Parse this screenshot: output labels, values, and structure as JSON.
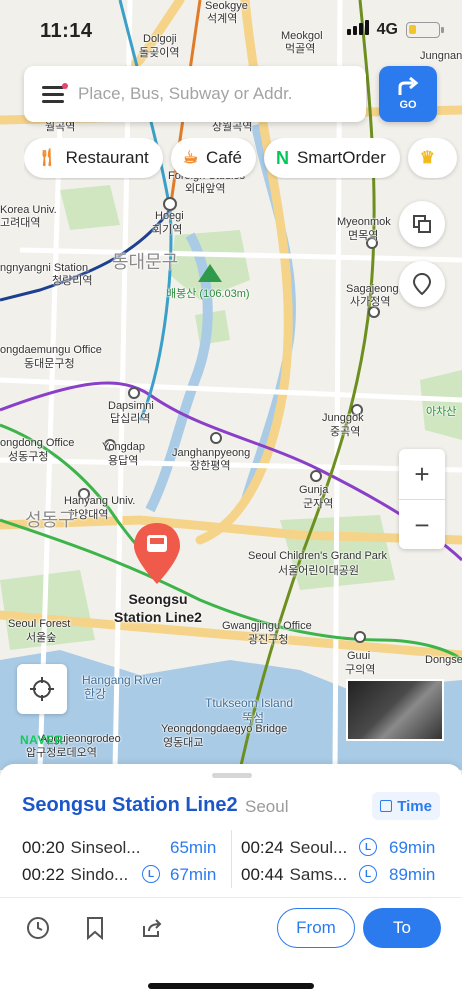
{
  "status_bar": {
    "time": "11:14",
    "network": "4G"
  },
  "search": {
    "placeholder": "Place, Bus, Subway or Addr.",
    "go_label": "GO"
  },
  "categories": [
    {
      "label": "Restaurant",
      "icon": "fork-icon",
      "color": "#f28a2e"
    },
    {
      "label": "Café",
      "icon": "cup-icon",
      "color": "#f28a2e"
    },
    {
      "label": "SmartOrder",
      "icon": "n-icon",
      "color": "#03c75a"
    }
  ],
  "map": {
    "labels": [
      {
        "text": "Seokgye",
        "cls": ""
      },
      {
        "text": "석계역",
        "cls": ""
      },
      {
        "text": "Meokgol",
        "cls": ""
      },
      {
        "text": "먹골역",
        "cls": ""
      },
      {
        "text": "Jungnan",
        "cls": ""
      },
      {
        "text": "Dolgoji",
        "cls": ""
      },
      {
        "text": "돌곶이역",
        "cls": ""
      },
      {
        "text": "월곡역",
        "cls": ""
      },
      {
        "text": "상월곡역",
        "cls": ""
      },
      {
        "text": "Korea Univ.",
        "cls": ""
      },
      {
        "text": "고려대역",
        "cls": ""
      },
      {
        "text": "Foreign Studies",
        "cls": ""
      },
      {
        "text": "외대앞역",
        "cls": ""
      },
      {
        "text": "Hoegi",
        "cls": ""
      },
      {
        "text": "회기역",
        "cls": ""
      },
      {
        "text": "Myeonmok",
        "cls": ""
      },
      {
        "text": "면목역",
        "cls": ""
      },
      {
        "text": "ngnyangni Station",
        "cls": ""
      },
      {
        "text": "청량리역",
        "cls": ""
      },
      {
        "text": "동대문구",
        "cls": "big"
      },
      {
        "text": "배봉산 (106.03m)",
        "cls": "green"
      },
      {
        "text": "Sagajeong",
        "cls": ""
      },
      {
        "text": "사가정역",
        "cls": ""
      },
      {
        "text": "ongdaemungu Office",
        "cls": ""
      },
      {
        "text": "동대문구청",
        "cls": ""
      },
      {
        "text": "Dapsimni",
        "cls": ""
      },
      {
        "text": "답십리역",
        "cls": ""
      },
      {
        "text": "Junggok",
        "cls": ""
      },
      {
        "text": "중곡역",
        "cls": ""
      },
      {
        "text": "아차산",
        "cls": "green"
      },
      {
        "text": "ongdong Office",
        "cls": ""
      },
      {
        "text": "성동구청",
        "cls": ""
      },
      {
        "text": "Yongdap",
        "cls": ""
      },
      {
        "text": "용답역",
        "cls": ""
      },
      {
        "text": "Janghanpyeong",
        "cls": ""
      },
      {
        "text": "장한평역",
        "cls": ""
      },
      {
        "text": "Gunja",
        "cls": ""
      },
      {
        "text": "군자역",
        "cls": ""
      },
      {
        "text": "Hanyang Univ.",
        "cls": ""
      },
      {
        "text": "한양대역",
        "cls": ""
      },
      {
        "text": "성동구",
        "cls": "big"
      },
      {
        "text": "Seoul Children's Grand Park",
        "cls": ""
      },
      {
        "text": "서울어린이대공원",
        "cls": ""
      },
      {
        "text": "Seoul Forest",
        "cls": ""
      },
      {
        "text": "서울숲",
        "cls": ""
      },
      {
        "text": "Gwangjingu Office",
        "cls": ""
      },
      {
        "text": "광진구청",
        "cls": ""
      },
      {
        "text": "Guui",
        "cls": ""
      },
      {
        "text": "구의역",
        "cls": ""
      },
      {
        "text": "Dongse",
        "cls": ""
      },
      {
        "text": "Hangang River",
        "cls": "water"
      },
      {
        "text": "한강",
        "cls": "water"
      },
      {
        "text": "Ttukseom Island",
        "cls": "water"
      },
      {
        "text": "뚝섬",
        "cls": "water"
      },
      {
        "text": "Yeongdongdaegyo Bridge",
        "cls": ""
      },
      {
        "text": "영동대교",
        "cls": ""
      },
      {
        "text": "Apgujeongrodeo",
        "cls": ""
      },
      {
        "text": "압구정로데오역",
        "cls": ""
      }
    ],
    "pin": {
      "line1": "Seongsu",
      "line2": "Station Line2"
    },
    "brand": "NAVER"
  },
  "station_card": {
    "name": "Seongsu Station Line2",
    "city": "Seoul",
    "time_button": "Time",
    "departures": [
      {
        "time": "00:20",
        "destination": "Sinseol...",
        "minutes": "65min",
        "local": false
      },
      {
        "time": "00:22",
        "destination": "Sindo...",
        "minutes": "67min",
        "local": true
      },
      {
        "time": "00:24",
        "destination": "Seoul...",
        "minutes": "69min",
        "local": true
      },
      {
        "time": "00:44",
        "destination": "Sams...",
        "minutes": "89min",
        "local": true
      }
    ],
    "local_badge": "L",
    "from_label": "From",
    "to_label": "To"
  },
  "colors": {
    "accent": "#2b7bef",
    "title": "#1b57c9",
    "line2": "#3cb44a",
    "line5": "#8a3fc8",
    "line7": "#6d8f1f"
  }
}
